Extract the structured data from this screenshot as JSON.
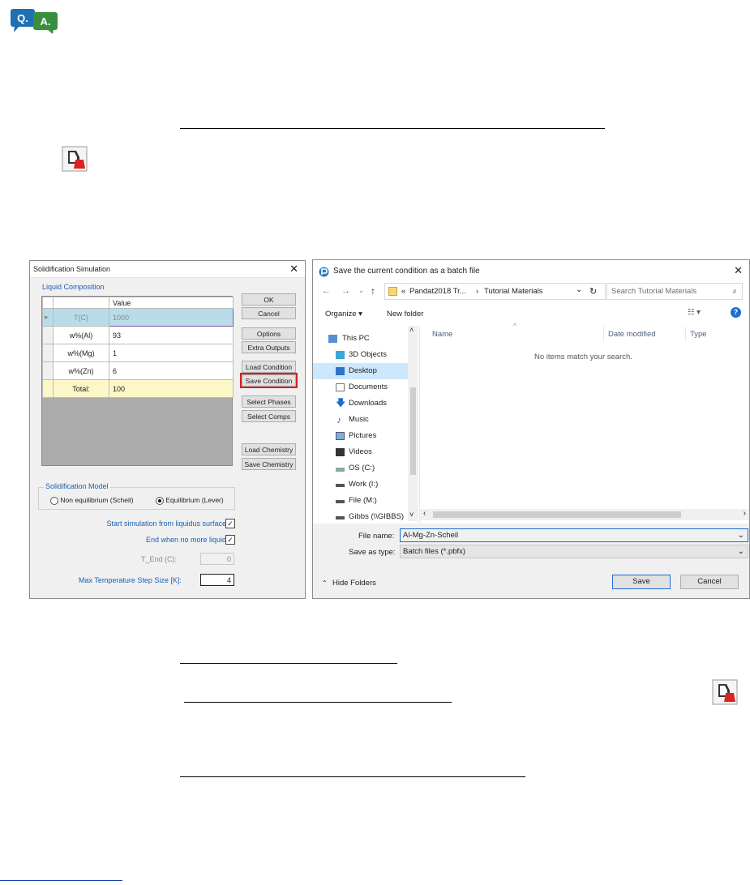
{
  "logo": {
    "text": "Q.A.",
    "colors": {
      "q_bubble": "#1f6fb5",
      "a_bubble": "#3a8f3e"
    }
  },
  "solidification_dialog": {
    "title": "Solidification Simulation",
    "close_glyph": "✕",
    "liquid_composition_label": "Liquid Composition",
    "grid": {
      "value_header": "Value",
      "rows": [
        {
          "name": "T(C)",
          "value": "1000",
          "selected": true
        },
        {
          "name": "w%(Al)",
          "value": "93"
        },
        {
          "name": "w%(Mg)",
          "value": "1"
        },
        {
          "name": "w%(Zn)",
          "value": "6"
        },
        {
          "name": "Total:",
          "value": "100",
          "total": true
        }
      ]
    },
    "buttons": {
      "ok": "OK",
      "cancel": "Cancel",
      "options": "Options",
      "extra_outputs": "Extra Outputs",
      "load_condition": "Load Condition",
      "save_condition": "Save Condition",
      "select_phases": "Select Phases",
      "select_comps": "Select Comps",
      "load_chemistry": "Load Chemistry",
      "save_chemistry": "Save Chemistry"
    },
    "model": {
      "label": "Solidification Model",
      "non_equilibrium": "Non equilibrium (Scheil)",
      "equilibrium": "Equilibrium (Lever)",
      "selected": "equilibrium"
    },
    "start_from_liquidus": {
      "label": "Start simulation from liquidus surface",
      "checked": true
    },
    "end_when_no_liquid": {
      "label": "End when no more liquid",
      "checked": true
    },
    "t_end": {
      "label": "T_End (C):",
      "value": "0"
    },
    "max_step": {
      "label": "Max Temperature Step Size [K]:",
      "value": "4"
    }
  },
  "save_dialog": {
    "title": "Save the current condition as a batch file",
    "close_glyph": "✕",
    "address": {
      "prefix": "«",
      "part1": "Pandat2018 Tr...",
      "sep": "›",
      "part2": "Tutorial Materials"
    },
    "search_placeholder": "Search Tutorial Materials",
    "organize": "Organize ▾",
    "new_folder": "New folder",
    "tree": [
      {
        "label": "This PC",
        "icon": "pc-icon"
      },
      {
        "label": "3D Objects",
        "icon": "cube-icon"
      },
      {
        "label": "Desktop",
        "icon": "desktop-icon",
        "selected": true
      },
      {
        "label": "Documents",
        "icon": "document-icon"
      },
      {
        "label": "Downloads",
        "icon": "download-icon"
      },
      {
        "label": "Music",
        "icon": "music-icon"
      },
      {
        "label": "Pictures",
        "icon": "picture-icon"
      },
      {
        "label": "Videos",
        "icon": "video-icon"
      },
      {
        "label": "OS (C:)",
        "icon": "drive-icon"
      },
      {
        "label": "Work (I:)",
        "icon": "drive-icon"
      },
      {
        "label": "File (M:)",
        "icon": "drive-icon"
      },
      {
        "label": "Gibbs (\\\\GIBBS)",
        "icon": "network-drive-icon"
      }
    ],
    "columns": {
      "name": "Name",
      "date": "Date modified",
      "type": "Type"
    },
    "empty_message": "No items match your search.",
    "file_name_label": "File name:",
    "file_name_value": "Al-Mg-Zn-Scheil",
    "save_as_type_label": "Save as type:",
    "save_as_type_value": "Batch files (*.pbfx)",
    "hide_folders": "Hide Folders",
    "save": "Save",
    "cancel": "Cancel"
  }
}
